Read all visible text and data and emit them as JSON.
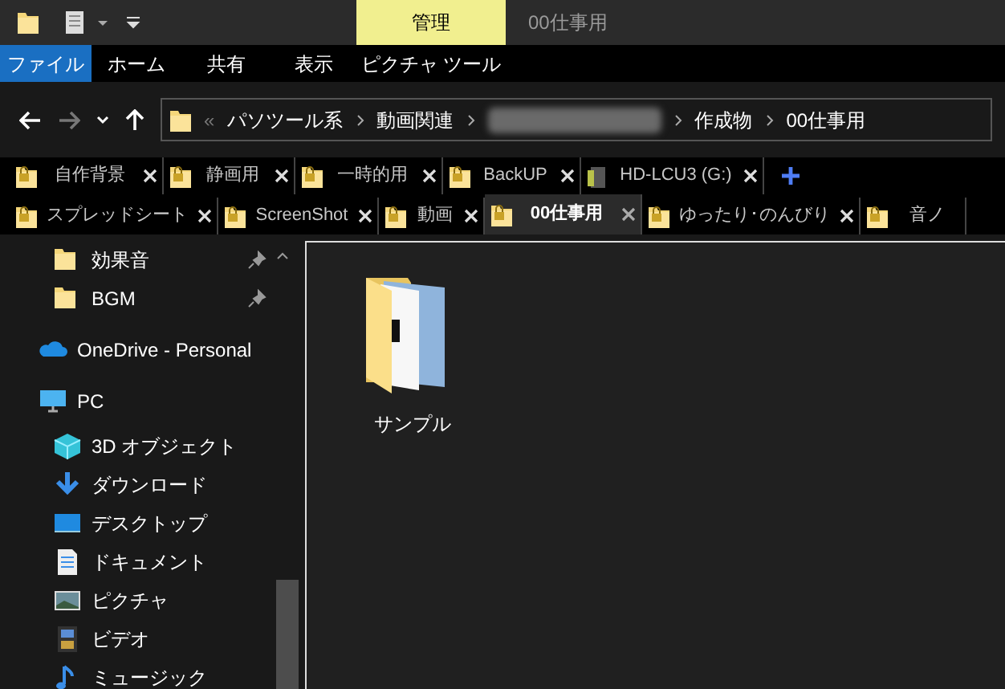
{
  "title_bar": {
    "context_tab": "管理",
    "title": "00仕事用"
  },
  "ribbon_tabs": [
    {
      "label": "ファイル",
      "selected": true
    },
    {
      "label": "ホーム",
      "selected": false
    },
    {
      "label": "共有",
      "selected": false
    },
    {
      "label": "表示",
      "selected": false
    },
    {
      "label": "ピクチャ ツール",
      "selected": false
    }
  ],
  "address_bar": {
    "overflow": "«",
    "segments": [
      {
        "kind": "text",
        "label": "パソツール系"
      },
      {
        "kind": "text",
        "label": "動画関連"
      },
      {
        "kind": "blurred"
      },
      {
        "kind": "text",
        "label": "作成物"
      },
      {
        "kind": "text",
        "label": "00仕事用"
      }
    ]
  },
  "folder_tabs": [
    [
      {
        "label": "自作背景",
        "kind": "folder",
        "selected": false
      },
      {
        "label": "静画用",
        "kind": "folder",
        "selected": false
      },
      {
        "label": "一時的用",
        "kind": "folder",
        "selected": false
      },
      {
        "label": "BackUP",
        "kind": "folder",
        "selected": false
      },
      {
        "label": "HD-LCU3 (G:)",
        "kind": "drive",
        "selected": false
      }
    ],
    [
      {
        "label": "スプレッドシート",
        "kind": "folder",
        "selected": false
      },
      {
        "label": "ScreenShot",
        "kind": "folder",
        "selected": false
      },
      {
        "label": "動画",
        "kind": "folder",
        "selected": false
      },
      {
        "label": "00仕事用",
        "kind": "folder",
        "selected": true
      },
      {
        "label": "ゆったり･のんびり",
        "kind": "folder",
        "selected": false
      },
      {
        "label": "音ノ",
        "kind": "folder",
        "selected": false
      }
    ]
  ],
  "sidebar": {
    "items": [
      {
        "label": "効果音",
        "kind": "folder",
        "pinned": true,
        "indent": true
      },
      {
        "label": "BGM",
        "kind": "folder",
        "pinned": true,
        "indent": true
      },
      {
        "label": "OneDrive - Personal",
        "kind": "cloud",
        "pinned": false,
        "indent": false
      },
      {
        "label": "PC",
        "kind": "pc",
        "pinned": false,
        "indent": false
      },
      {
        "label": "3D オブジェクト",
        "kind": "cube",
        "pinned": false,
        "indent": true
      },
      {
        "label": "ダウンロード",
        "kind": "download",
        "pinned": false,
        "indent": true
      },
      {
        "label": "デスクトップ",
        "kind": "desktop",
        "pinned": false,
        "indent": true
      },
      {
        "label": "ドキュメント",
        "kind": "document",
        "pinned": false,
        "indent": true
      },
      {
        "label": "ピクチャ",
        "kind": "picture",
        "pinned": false,
        "indent": true
      },
      {
        "label": "ビデオ",
        "kind": "video",
        "pinned": false,
        "indent": true
      },
      {
        "label": "ミュージック",
        "kind": "music",
        "pinned": false,
        "indent": true
      }
    ]
  },
  "files": [
    {
      "name": "サンプル"
    }
  ]
}
